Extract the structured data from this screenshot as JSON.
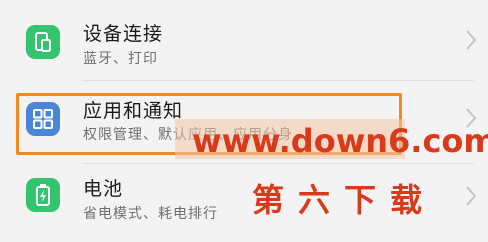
{
  "settings": {
    "items": [
      {
        "title": "设备连接",
        "subtitle": "蓝牙、打印",
        "icon": "device-connection-icon"
      },
      {
        "title": "应用和通知",
        "subtitle": "权限管理、默认应用、应用分身",
        "icon": "apps-grid-icon"
      },
      {
        "title": "电池",
        "subtitle": "省电模式、耗电排行",
        "icon": "battery-icon"
      }
    ]
  },
  "watermark": {
    "url": "www.down6.com",
    "name": "第六下载"
  },
  "colors": {
    "green_icon": "#35c46e",
    "blue_icon": "#4a86d8",
    "highlight_border": "#f08a1f",
    "watermark_text": "#d83a1c"
  }
}
